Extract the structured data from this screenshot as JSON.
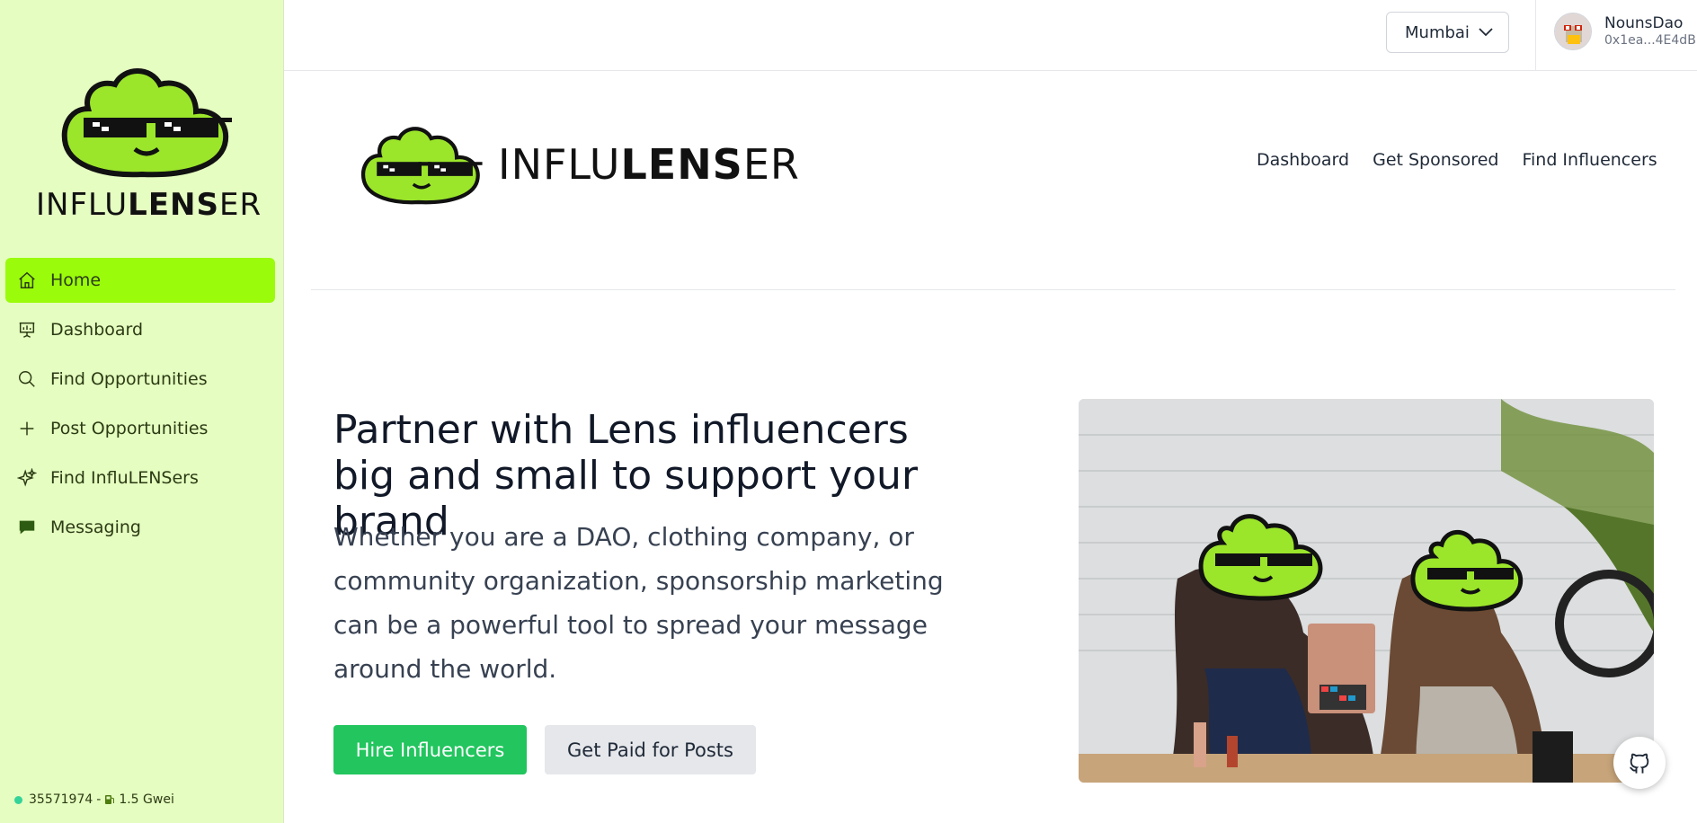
{
  "brand": {
    "name_pre": "INFLU",
    "name_bold": "LENS",
    "name_post": "ER"
  },
  "sidebar": {
    "items": [
      {
        "label": "Home",
        "icon": "home-icon",
        "active": true
      },
      {
        "label": "Dashboard",
        "icon": "presentation-chart-icon"
      },
      {
        "label": "Find Opportunities",
        "icon": "search-icon"
      },
      {
        "label": "Post Opportunities",
        "icon": "plus-icon"
      },
      {
        "label": "Find InfluLENSers",
        "icon": "sparkles-icon"
      },
      {
        "label": "Messaging",
        "icon": "chat-bubble-icon"
      }
    ],
    "footer": {
      "block": "35571974",
      "separator": "-",
      "gas": "1.5 Gwei"
    }
  },
  "topbar": {
    "network": "Mumbai",
    "user": {
      "name": "NounsDao",
      "address": "0x1ea...4E4dB"
    }
  },
  "header_nav": [
    "Dashboard",
    "Get Sponsored",
    "Find Influencers"
  ],
  "hero": {
    "title": "Partner with Lens influencers big and small to support your brand",
    "subtitle": "Whether you are a DAO, clothing company, or community organization, sponsorship marketing can be a powerful tool to spread your message around the world.",
    "primary_button": "Hire Influencers",
    "secondary_button": "Get Paid for Posts"
  },
  "colors": {
    "sidebar_bg": "#e5fdc0",
    "active_nav": "#9afc0a",
    "primary": "#22c55e",
    "mascot": "#9be52b"
  }
}
